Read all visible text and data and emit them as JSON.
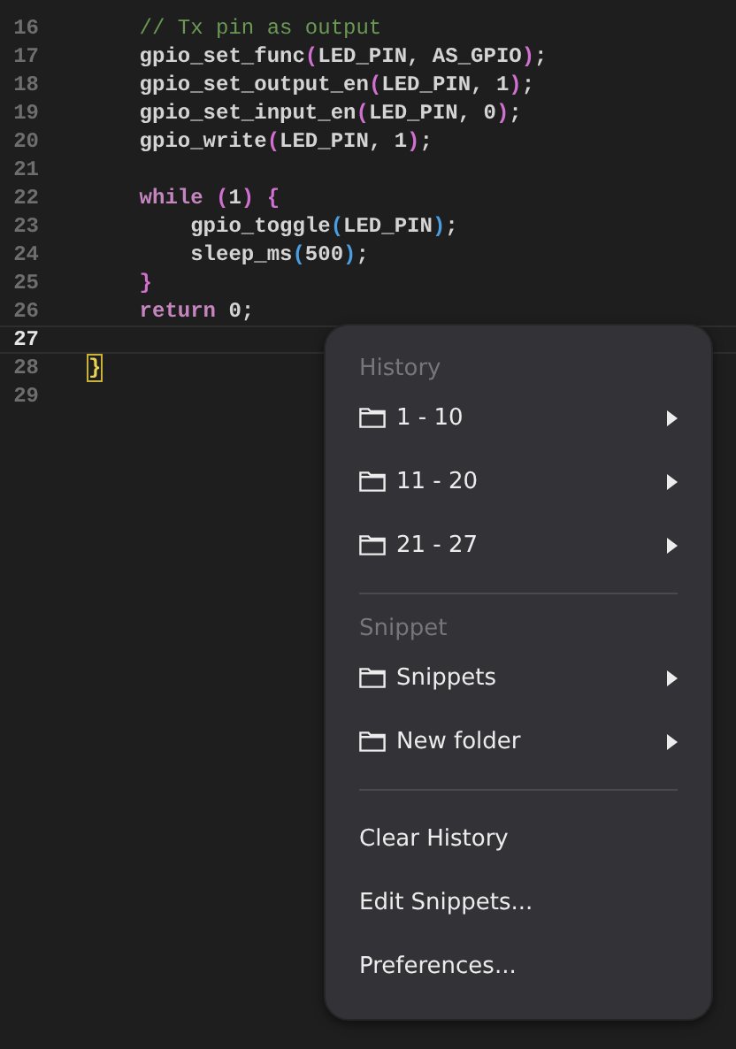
{
  "editor": {
    "lines": [
      {
        "number": "16",
        "current": false,
        "tokens": [
          {
            "kind": "comment",
            "text": "    // Tx pin as output"
          }
        ]
      },
      {
        "number": "17",
        "current": false,
        "tokens": [
          {
            "kind": "plain",
            "text": "    gpio_set_func"
          },
          {
            "kind": "bracket",
            "text": "("
          },
          {
            "kind": "plain",
            "text": "LED_PIN, AS_GPIO"
          },
          {
            "kind": "bracket",
            "text": ")"
          },
          {
            "kind": "plain",
            "text": ";"
          }
        ]
      },
      {
        "number": "18",
        "current": false,
        "tokens": [
          {
            "kind": "plain",
            "text": "    gpio_set_output_en"
          },
          {
            "kind": "bracket",
            "text": "("
          },
          {
            "kind": "plain",
            "text": "LED_PIN, 1"
          },
          {
            "kind": "bracket",
            "text": ")"
          },
          {
            "kind": "plain",
            "text": ";"
          }
        ]
      },
      {
        "number": "19",
        "current": false,
        "tokens": [
          {
            "kind": "plain",
            "text": "    gpio_set_input_en"
          },
          {
            "kind": "bracket",
            "text": "("
          },
          {
            "kind": "plain",
            "text": "LED_PIN, 0"
          },
          {
            "kind": "bracket",
            "text": ")"
          },
          {
            "kind": "plain",
            "text": ";"
          }
        ]
      },
      {
        "number": "20",
        "current": false,
        "tokens": [
          {
            "kind": "plain",
            "text": "    gpio_write"
          },
          {
            "kind": "bracket",
            "text": "("
          },
          {
            "kind": "plain",
            "text": "LED_PIN, 1"
          },
          {
            "kind": "bracket",
            "text": ")"
          },
          {
            "kind": "plain",
            "text": ";"
          }
        ]
      },
      {
        "number": "21",
        "current": false
      },
      {
        "number": "22",
        "current": false,
        "tokens": [
          {
            "kind": "keyword",
            "text": "    while"
          },
          {
            "kind": "bracket",
            "text": " ("
          },
          {
            "kind": "plain",
            "text": "1"
          },
          {
            "kind": "bracket",
            "text": ") {"
          }
        ]
      },
      {
        "number": "23",
        "current": false,
        "tokens": [
          {
            "kind": "plain",
            "text": "        gpio_toggle"
          },
          {
            "kind": "bracket2",
            "text": "("
          },
          {
            "kind": "plain",
            "text": "LED_PIN"
          },
          {
            "kind": "bracket2",
            "text": ")"
          },
          {
            "kind": "plain",
            "text": ";"
          }
        ]
      },
      {
        "number": "24",
        "current": false,
        "tokens": [
          {
            "kind": "plain",
            "text": "        sleep_ms"
          },
          {
            "kind": "bracket2",
            "text": "("
          },
          {
            "kind": "plain",
            "text": "500"
          },
          {
            "kind": "bracket2",
            "text": ")"
          },
          {
            "kind": "plain",
            "text": ";"
          }
        ]
      },
      {
        "number": "25",
        "current": false,
        "tokens": [
          {
            "kind": "bracket",
            "text": "    }"
          }
        ]
      },
      {
        "number": "26",
        "current": false,
        "tokens": [
          {
            "kind": "keyword",
            "text": "    return"
          },
          {
            "kind": "plain",
            "text": " 0;"
          }
        ]
      },
      {
        "number": "27",
        "current": true
      },
      {
        "number": "28",
        "current": false,
        "tokens": [
          {
            "kind": "matched",
            "text": "}"
          }
        ]
      },
      {
        "number": "29",
        "current": false
      }
    ]
  },
  "menu": {
    "sections": [
      {
        "header": "History",
        "items": [
          {
            "kind": "submenu",
            "label": "1 - 10"
          },
          {
            "kind": "submenu",
            "label": "11 - 20"
          },
          {
            "kind": "submenu",
            "label": "21 - 27"
          }
        ]
      },
      {
        "header": "Snippet",
        "items": [
          {
            "kind": "submenu",
            "label": "Snippets"
          },
          {
            "kind": "submenu",
            "label": "New folder"
          }
        ]
      },
      {
        "items": [
          {
            "kind": "action",
            "label": "Clear History"
          },
          {
            "kind": "action",
            "label": "Edit Snippets..."
          },
          {
            "kind": "action",
            "label": "Preferences..."
          }
        ]
      }
    ]
  }
}
